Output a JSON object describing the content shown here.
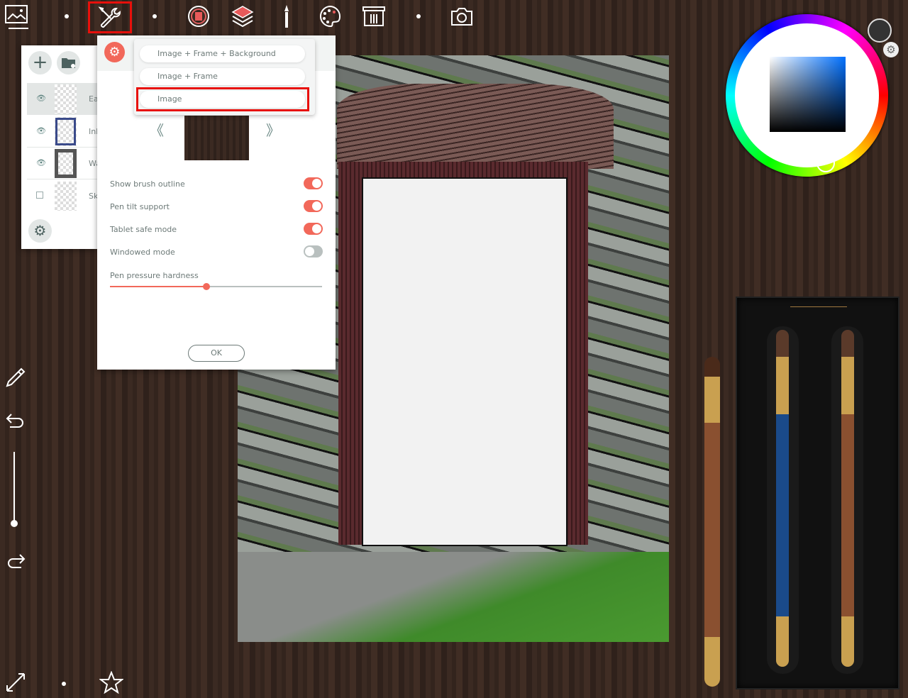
{
  "toolbar": {
    "items": [
      "gallery-icon",
      "tools-icon",
      "canvas-icon",
      "layers-icon",
      "brush-icon",
      "palette-icon",
      "brush-library-icon",
      "camera-icon"
    ],
    "highlight_color": "#e8100b"
  },
  "layers": {
    "items": [
      {
        "name": "Ea",
        "visible": true
      },
      {
        "name": "Ink",
        "visible": true
      },
      {
        "name": "Wa",
        "visible": true
      },
      {
        "name": "Sk",
        "visible": false
      }
    ]
  },
  "settings": {
    "export_options": [
      "Image + Frame + Background",
      "Image + Frame",
      "Image"
    ],
    "selected_option": "Image",
    "prev_label": "《",
    "next_label": "》",
    "toggles": [
      {
        "label": "Show brush outline",
        "on": true
      },
      {
        "label": "Pen tilt support",
        "on": true
      },
      {
        "label": "Tablet safe mode",
        "on": true
      },
      {
        "label": "Windowed mode",
        "on": false
      }
    ],
    "slider_label": "Pen pressure hardness",
    "slider_value": 0.45,
    "ok_label": "OK",
    "accent": "#f2685a"
  },
  "colors": {
    "current": "#333333",
    "picker_hue": "#0070ff"
  }
}
